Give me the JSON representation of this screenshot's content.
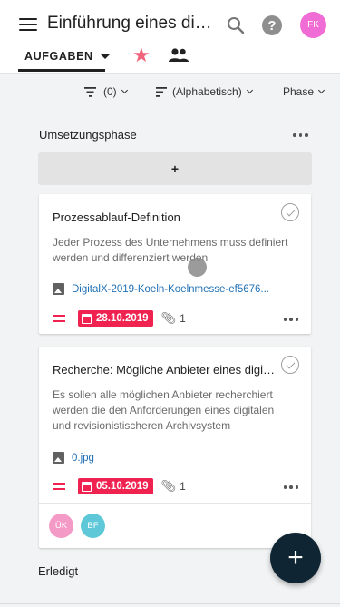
{
  "header": {
    "title": "Einführung eines digitalen Archivsystems",
    "avatar_initials": "FK",
    "tab_label": "AUFGABEN",
    "help_label": "?"
  },
  "filters": {
    "filter_label": "(0)",
    "sort_label": "(Alphabetisch)",
    "phase_label": "Phase"
  },
  "columns": [
    {
      "title": "Umsetzungsphase",
      "add_label": "+",
      "cards": [
        {
          "title": "Prozessablauf-Definition",
          "description": "Jeder Prozess des Unternehmens muss definiert werden und differenziert werden",
          "attachment": "DigitalX-2019-Koeln-Koelnmesse-ef5676...",
          "due_date": "28.10.2019",
          "attachment_count": "1"
        },
        {
          "title": "Recherche: Mögliche Anbieter eines digitalen Archivsystems",
          "description": "Es sollen alle möglichen Anbieter recherchiert werden die den Anforderungen eines digitalen und revisionistischeren Archivsystem",
          "attachment": "0.jpg",
          "due_date": "05.10.2019",
          "attachment_count": "1",
          "members": [
            "ÜK",
            "BF"
          ]
        }
      ]
    },
    {
      "title": "Erledigt"
    }
  ],
  "fab_label": "+",
  "colors": {
    "accent_red": "#f0224f",
    "star": "#f0637a",
    "fab": "#0f2533",
    "link": "#1f6fb5"
  }
}
